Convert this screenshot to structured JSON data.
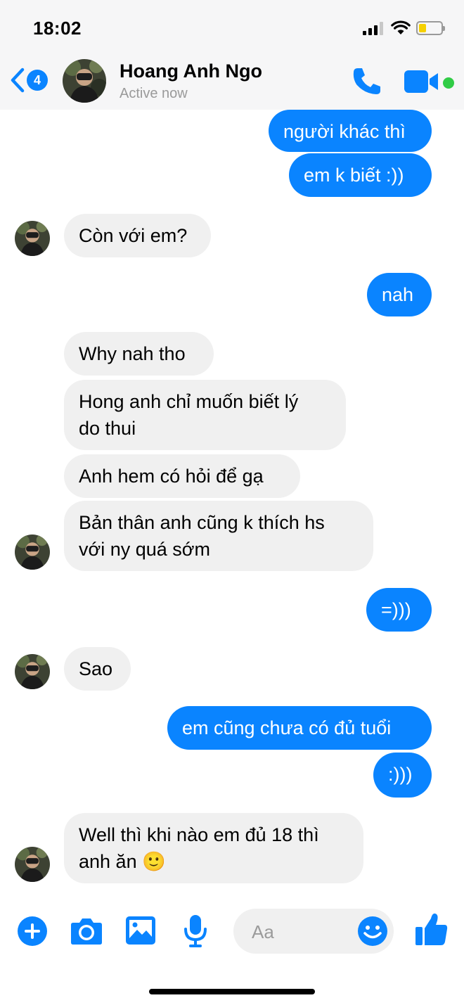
{
  "status_bar": {
    "time": "18:02",
    "battery_level": 0.33
  },
  "header": {
    "back_count": "4",
    "contact_name": "Hoang Anh Ngo",
    "contact_status": "Active now",
    "accent_color": "#0a84ff",
    "online_color": "#31cc46",
    "icons": [
      "chevron-left-icon",
      "phone-icon",
      "video-camera-icon"
    ]
  },
  "messages": [
    {
      "from": "me",
      "text": "người khác thì"
    },
    {
      "from": "me",
      "text": "em k biết :))"
    },
    {
      "from": "them",
      "text": "Còn với em?"
    },
    {
      "from": "me",
      "text": "nah"
    },
    {
      "from": "them",
      "text": "Why nah tho"
    },
    {
      "from": "them",
      "lines": [
        "Hong anh chỉ muốn biết lý",
        "do thui"
      ]
    },
    {
      "from": "them",
      "text": "Anh hem có hỏi để gạ"
    },
    {
      "from": "them",
      "lines": [
        "Bản thân anh cũng k thích hs",
        "với ny quá sớm"
      ]
    },
    {
      "from": "me",
      "text": "=)))"
    },
    {
      "from": "them",
      "text": "Sao"
    },
    {
      "from": "me",
      "text": "em cũng chưa có đủ tuổi"
    },
    {
      "from": "me",
      "text": ":)))"
    },
    {
      "from": "them",
      "lines": [
        "Well thì khi nào em đủ 18 thì",
        "anh ăn 🙂"
      ]
    }
  ],
  "composer": {
    "placeholder": "Aa",
    "icons": [
      "plus-icon",
      "camera-icon",
      "image-icon",
      "microphone-icon",
      "emoji-icon",
      "thumbs-up-icon"
    ]
  }
}
